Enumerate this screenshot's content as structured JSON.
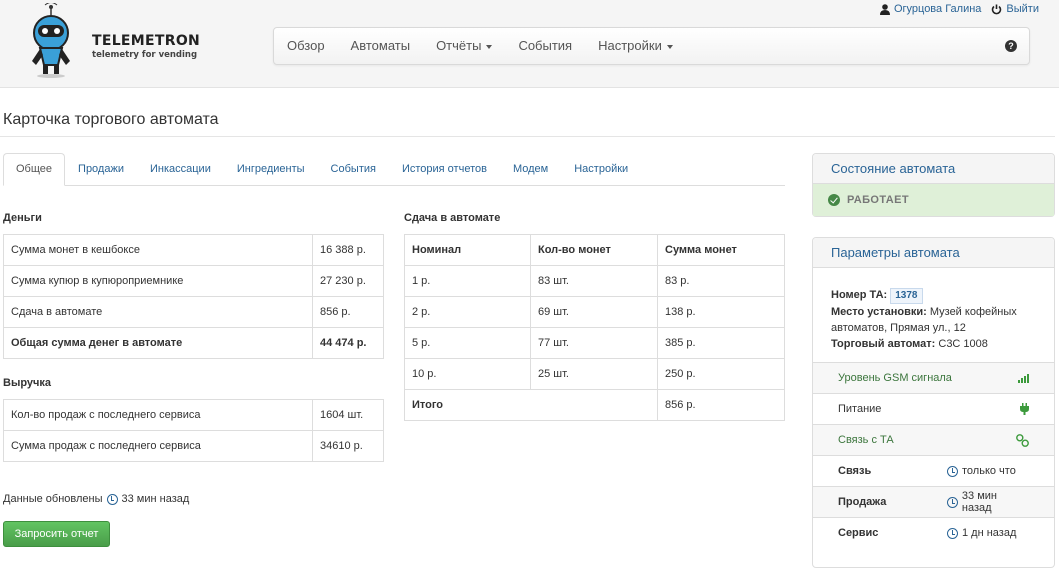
{
  "brand": {
    "title": "TELEMETRON",
    "subtitle": "telemetry for vending"
  },
  "user": {
    "name": "Огурцова Галина",
    "logout": "Выйти"
  },
  "nav": {
    "items": [
      "Обзор",
      "Автоматы",
      "Отчёты",
      "События",
      "Настройки"
    ]
  },
  "page": {
    "title": "Карточка торгового автомата"
  },
  "tabs": [
    "Общее",
    "Продажи",
    "Инкассации",
    "Ингредиенты",
    "События",
    "История отчетов",
    "Модем",
    "Настройки"
  ],
  "money": {
    "title": "Деньги",
    "rows": [
      {
        "label": "Сумма монет в кешбоксе",
        "value": "16 388 р."
      },
      {
        "label": "Сумма купюр в купюроприемнике",
        "value": "27 230 р."
      },
      {
        "label": "Сдача в автомате",
        "value": "856 р."
      },
      {
        "label": "Общая сумма денег в автомате",
        "value": "44 474 р."
      }
    ]
  },
  "revenue": {
    "title": "Выручка",
    "rows": [
      {
        "label": "Кол-во продаж с последнего сервиса",
        "value": "1604 шт."
      },
      {
        "label": "Сумма продаж с последнего сервиса",
        "value": "34610 р."
      }
    ]
  },
  "change": {
    "title": "Сдача в автомате",
    "headers": [
      "Номинал",
      "Кол-во монет",
      "Сумма монет"
    ],
    "rows": [
      [
        "1 р.",
        "83 шт.",
        "83 р."
      ],
      [
        "2 р.",
        "69 шт.",
        "138 р."
      ],
      [
        "5 р.",
        "77 шт.",
        "385 р."
      ],
      [
        "10 р.",
        "25 шт.",
        "250 р."
      ]
    ],
    "total_label": "Итого",
    "total_value": "856 р."
  },
  "updated": {
    "label": "Данные обновлены",
    "time": "33 мин назад"
  },
  "report_button": "Запросить отчет",
  "status_panel": {
    "title": "Состояние автомата",
    "status": "РАБОТАЕТ"
  },
  "params_panel": {
    "title": "Параметры автомата",
    "number_label": "Номер ТА:",
    "number": "1378",
    "location_label": "Место установки:",
    "location": "Музей кофейных автоматов, Прямая ул., 12",
    "machine_label": "Торговый автомат:",
    "machine": "C3C 1008",
    "indicators": [
      {
        "label": "Уровень GSM сигнала",
        "icon": "signal-bars-icon"
      },
      {
        "label": "Питание",
        "icon": "power-plug-icon"
      },
      {
        "label": "Связь с ТА",
        "icon": "link-icon"
      }
    ],
    "times": [
      {
        "label": "Связь",
        "value": "только что"
      },
      {
        "label": "Продажа",
        "value": "33 мин назад"
      },
      {
        "label": "Сервис",
        "value": "1 дн назад"
      }
    ]
  },
  "colors": {
    "link": "#2a6496",
    "success": "#5cb85c",
    "status_bg": "#dff0d8",
    "green_text": "#3c763d"
  }
}
